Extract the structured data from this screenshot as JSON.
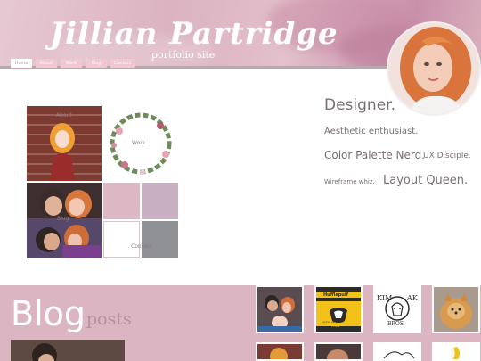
{
  "header": {
    "title": "Jillian Partridge",
    "subtitle": "portfolio site"
  },
  "nav": {
    "tabs": [
      {
        "label": "Home",
        "active": true
      },
      {
        "label": "About",
        "active": false
      },
      {
        "label": "Work",
        "active": false
      },
      {
        "label": "Blog",
        "active": false
      },
      {
        "label": "Contact",
        "active": false
      }
    ]
  },
  "grid": {
    "about_label": "About",
    "work_label": "Work",
    "blog_label": "Blog",
    "contact_label": "Contact",
    "swatches": [
      "#dbb8c3",
      "#c9afc2",
      "#ffffff",
      "#8f9194"
    ]
  },
  "taglines": {
    "designer": "Designer.",
    "aesthetic": "Aesthetic enthusiast.",
    "palette": "Color Palette Nerd.",
    "ux": "UX Disciple.",
    "wireframe": "Wireframe whiz.",
    "layout": "Layout Queen."
  },
  "blog": {
    "title": "Blog",
    "subtitle": "posts",
    "thumbs": [
      {
        "icon": "family-photo"
      },
      {
        "icon": "hufflepuff-badge",
        "caption": "Hufflepuff",
        "subcaption": "you've very kind",
        "tag": "FIND"
      },
      {
        "icon": "kim-bros-logo",
        "caption": "KIM",
        "caption2": "AK",
        "subcaption": "BROS"
      },
      {
        "icon": "pomeranian-photo"
      }
    ]
  },
  "colors": {
    "accent": "#dbb6c2",
    "header_pink": "#c990aa"
  }
}
